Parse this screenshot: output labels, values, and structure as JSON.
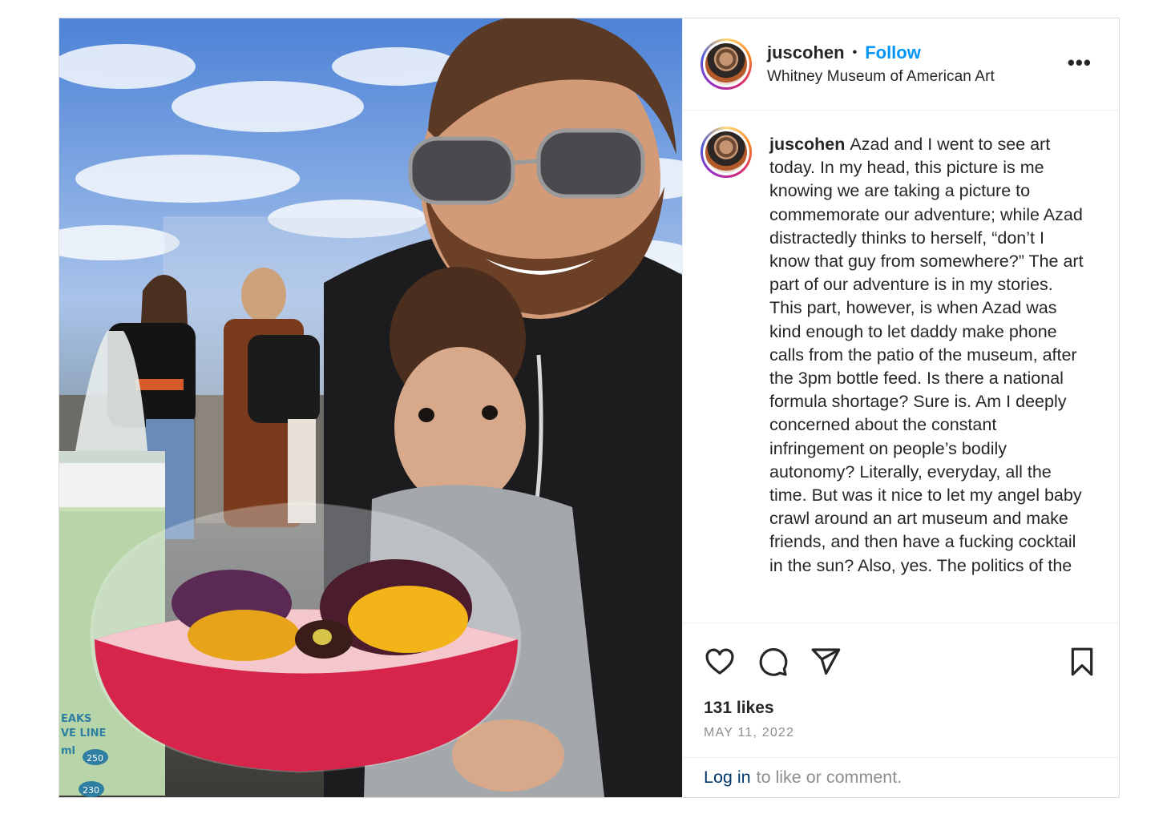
{
  "post": {
    "author": {
      "username": "juscohen",
      "location": "Whitney Museum of American Art"
    },
    "header": {
      "separator": "•",
      "follow_label": "Follow",
      "more_label": "•••"
    },
    "caption": {
      "username": "juscohen",
      "text": "Azad and I went to see art today. In my head, this picture is me knowing we are taking a picture to commemorate our adventure; while Azad distractedly thinks to herself, “don’t I know that guy from somewhere?” The art part of our adventure is in my stories. This part, however, is when Azad was kind enough to let daddy make phone calls from the patio of the museum, after the 3pm bottle feed. Is there a national formula shortage? Sure is. Am I deeply concerned about the constant infringement on people’s bodily autonomy? Literally, everyday, all the time. But was it nice to let my angel baby crawl around an art museum and make friends, and then have a fucking cocktail in the sun? Also, yes. The politics of the"
    },
    "actions": {
      "icons": [
        "heart-icon",
        "comment-icon",
        "share-icon",
        "bookmark-icon"
      ]
    },
    "likes_text": "131 likes",
    "date_text": "MAY 11, 2022",
    "login": {
      "link_label": "Log in",
      "suffix": "to like or comment."
    },
    "photo": {
      "bottle_text": [
        "EAKS",
        "VE LINE",
        "ml",
        "250",
        "230"
      ]
    }
  },
  "colors": {
    "follow": "#0095f6",
    "login_link": "#00376b",
    "muted": "#8e8e8e",
    "text": "#262626",
    "border": "#dbdbdb"
  }
}
